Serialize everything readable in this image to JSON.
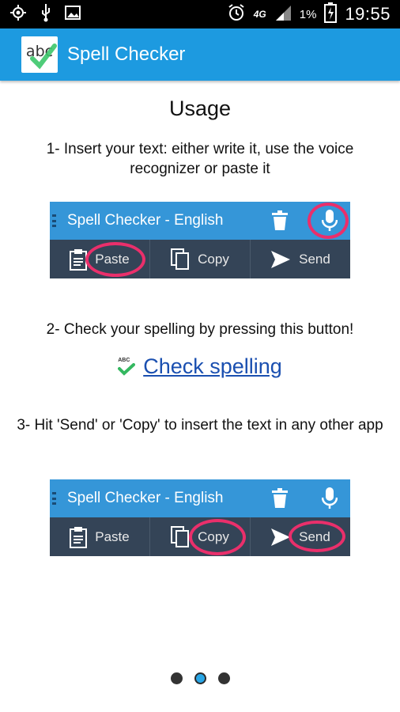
{
  "statusbar": {
    "battery_pct": "1%",
    "network": "4G",
    "time": "19:55"
  },
  "appbar": {
    "logo_text": "abc",
    "title": "Spell Checker"
  },
  "page": {
    "heading": "Usage",
    "step1": "1- Insert your text: either write it, use the voice recognizer or paste it",
    "step2": "2- Check your spelling by pressing this button!",
    "check_label": "Check spelling",
    "check_icon_text": "ABC",
    "step3": "3- Hit 'Send' or 'Copy' to insert the text in any other app"
  },
  "shot1": {
    "title": "Spell Checker - English",
    "paste": "Paste",
    "copy": "Copy",
    "send": "Send"
  },
  "shot2": {
    "title": "Spell Checker - English",
    "paste": "Paste",
    "copy": "Copy",
    "send": "Send"
  },
  "pager": {
    "count": 3,
    "active_index": 1
  },
  "colors": {
    "appbar": "#1d9ae0",
    "highlight_ring": "#ea2f6b",
    "link": "#1a4fb0"
  }
}
